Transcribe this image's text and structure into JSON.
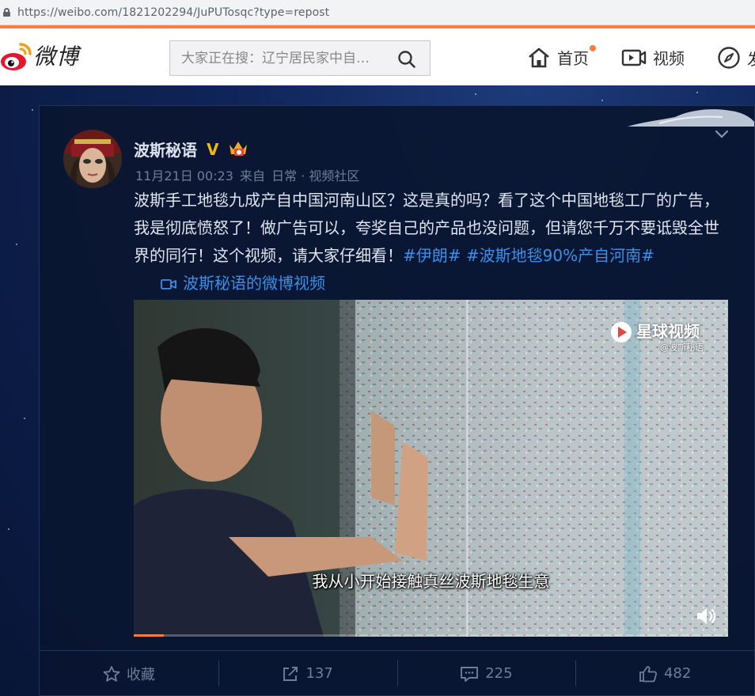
{
  "browser": {
    "url": "https://weibo.com/1821202294/JuPUTosqc?type=repost"
  },
  "nav": {
    "logo_text": "微博",
    "search_placeholder": "大家正在搜：辽宁居民家中自…",
    "items": [
      {
        "label": "首页",
        "icon": "home-icon",
        "has_dot": true
      },
      {
        "label": "视频",
        "icon": "video-icon"
      },
      {
        "label": "发",
        "icon": "compass-icon"
      }
    ]
  },
  "post": {
    "username": "波斯秘语",
    "verified_mark": "V",
    "meta": {
      "time": "11月21日 00:23",
      "source_prefix": "来自",
      "source": "日常 · 视频社区"
    },
    "content": {
      "text": "波斯手工地毯九成产自中国河南山区？这是真的吗？看了这个中国地毯工厂的广告，我是彻底愤怒了！做广告可以，夸奖自己的产品也没问题，但请您千万不要诋毁全世界的同行！这个视频，请大家仔细看！",
      "tag1": "#伊朗#",
      "tag2": "#波斯地毯90%产自河南#",
      "video_link": "波斯秘语的微博视频"
    },
    "video": {
      "subtitle": "我从小开始接触真丝波斯地毯生意",
      "watermark_title": "星球视频",
      "watermark_sub": "@波斯秘语",
      "progress": 0.05
    },
    "actions": [
      {
        "icon": "star-icon",
        "label": "收藏"
      },
      {
        "icon": "share-icon",
        "label": "137"
      },
      {
        "icon": "comment-icon",
        "label": "225"
      },
      {
        "icon": "like-icon",
        "label": "482"
      }
    ]
  },
  "colors": {
    "accent_orange": "#fa7d3c",
    "link_blue": "#3a8fe8",
    "verified_gold": "#f0b90b"
  }
}
